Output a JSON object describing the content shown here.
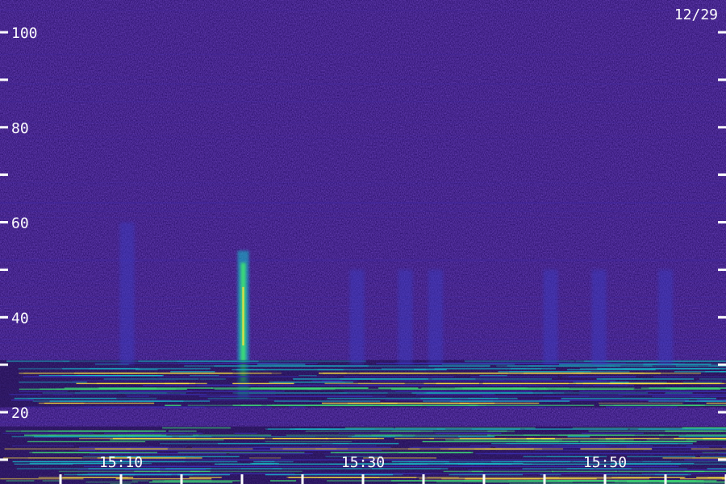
{
  "date_label": "12/29",
  "colors": {
    "background": "#2a0f6b",
    "noise_blue": "#3b2db0",
    "band_cyan": "#19b7c7",
    "band_green": "#3ee076",
    "burst_yellow": "#ffe23d",
    "axis_text": "#ffffff"
  },
  "chart_data": {
    "type": "heatmap",
    "title": "",
    "xlabel": "",
    "ylabel": "",
    "ylim": [
      0,
      105
    ],
    "y_ticks": [
      100,
      80,
      60,
      40,
      20
    ],
    "y_tick_labels": [
      "100",
      "80",
      "60",
      "40",
      "20"
    ],
    "x_tick_labels": [
      "15:10",
      "15:30",
      "15:50"
    ],
    "x_ticks_minutes": [
      10,
      30,
      50
    ],
    "xlim_minutes": [
      5,
      60
    ],
    "features": [
      {
        "name": "",
        "kind": "burst",
        "time_minutes": 20.1,
        "y_range": [
          23,
          54
        ],
        "intensity": 1.0
      },
      {
        "name": "",
        "kind": "band",
        "time_range": [
          5,
          60
        ],
        "y_range": [
          21,
          31
        ],
        "intensity": 0.55
      },
      {
        "name": "",
        "kind": "band",
        "time_range": [
          5,
          60
        ],
        "y_range": [
          4,
          17
        ],
        "intensity": 0.85
      },
      {
        "name": "",
        "kind": "weak",
        "time_minutes": 10.5,
        "y_range": [
          30,
          60
        ],
        "intensity": 0.25
      },
      {
        "name": "",
        "kind": "weak",
        "time_minutes": 29.5,
        "y_range": [
          30,
          50
        ],
        "intensity": 0.25
      },
      {
        "name": "",
        "kind": "weak",
        "time_minutes": 33.5,
        "y_range": [
          30,
          50
        ],
        "intensity": 0.25
      },
      {
        "name": "",
        "kind": "weak",
        "time_minutes": 36.0,
        "y_range": [
          30,
          50
        ],
        "intensity": 0.25
      },
      {
        "name": "",
        "kind": "weak",
        "time_minutes": 45.5,
        "y_range": [
          30,
          50
        ],
        "intensity": 0.25
      },
      {
        "name": "",
        "kind": "weak",
        "time_minutes": 49.5,
        "y_range": [
          30,
          50
        ],
        "intensity": 0.25
      },
      {
        "name": "",
        "kind": "weak",
        "time_minutes": 55.0,
        "y_range": [
          30,
          50
        ],
        "intensity": 0.25
      }
    ]
  }
}
